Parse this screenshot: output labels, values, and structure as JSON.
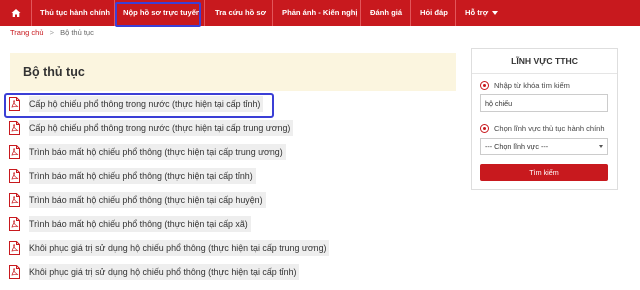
{
  "nav": {
    "items": [
      {
        "label": "Thủ tục hành chính"
      },
      {
        "label": "Nộp hồ sơ trực tuyến"
      },
      {
        "label": "Tra cứu hồ sơ"
      },
      {
        "label": "Phản ánh - Kiến nghị"
      },
      {
        "label": "Đánh giá"
      },
      {
        "label": "Hỏi đáp"
      },
      {
        "label": "Hỗ trợ"
      }
    ],
    "color": "#c8191e",
    "highlight_color": "#3b3fd6"
  },
  "breadcrumb": {
    "home": "Trang chủ",
    "separator": ">",
    "current": "Bộ thủ tục"
  },
  "main": {
    "title": "Bộ thủ tục",
    "procedures": [
      "Cấp hộ chiếu phổ thông trong nước (thực hiện tại cấp tỉnh)",
      "Cấp hộ chiếu phổ thông trong nước (thực hiện tại cấp trung ương)",
      "Trình báo mất hộ chiếu phổ thông (thực hiện tại cấp trung ương)",
      "Trình báo mất hộ chiếu phổ thông (thực hiện tại cấp tỉnh)",
      "Trình báo mất hộ chiếu phổ thông (thực hiện tại cấp huyện)",
      "Trình báo mất hộ chiếu phổ thông (thực hiện tại cấp xã)",
      "Khôi phục giá trị sử dụng hộ chiếu phổ thông (thực hiện tại cấp trung ương)",
      "Khôi phục giá trị sử dụng hộ chiếu phổ thông (thực hiện tại cấp tỉnh)"
    ]
  },
  "sidebar": {
    "title": "LĨNH VỰC TTHC",
    "keyword_label": "Nhập từ khóa tìm kiếm",
    "keyword_value": "hộ chiếu",
    "field_label": "Chọn lĩnh vực thủ tục hành chính",
    "field_select": "--- Chọn lĩnh vực ---",
    "search_button": "Tìm kiếm"
  }
}
